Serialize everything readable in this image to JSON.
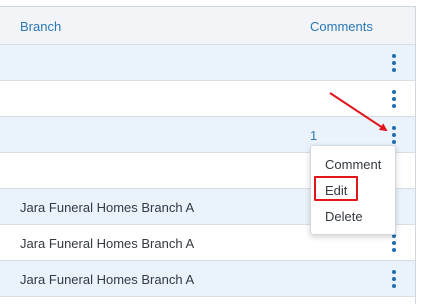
{
  "table": {
    "headers": {
      "branch": "Branch",
      "comments": "Comments"
    },
    "rows": [
      {
        "branch": "",
        "comments": ""
      },
      {
        "branch": "",
        "comments": ""
      },
      {
        "branch": "",
        "comments": "1"
      },
      {
        "branch": "",
        "comments": ""
      },
      {
        "branch": "Jara Funeral Homes Branch A",
        "comments": ""
      },
      {
        "branch": "Jara Funeral Homes Branch A",
        "comments": ""
      },
      {
        "branch": "Jara Funeral Homes Branch A",
        "comments": ""
      }
    ]
  },
  "row_menu": {
    "items": [
      "Comment",
      "Edit",
      "Delete"
    ]
  },
  "annotation": {
    "color": "#e0161b",
    "highlighted_item": "Edit"
  },
  "colors": {
    "header_text": "#2a78b5",
    "row_alt_bg": "#eaf2fb",
    "kebab": "#1f6fb0"
  },
  "icons": {
    "row_actions": "kebab-menu-icon",
    "pointer": "red-arrow-icon"
  }
}
